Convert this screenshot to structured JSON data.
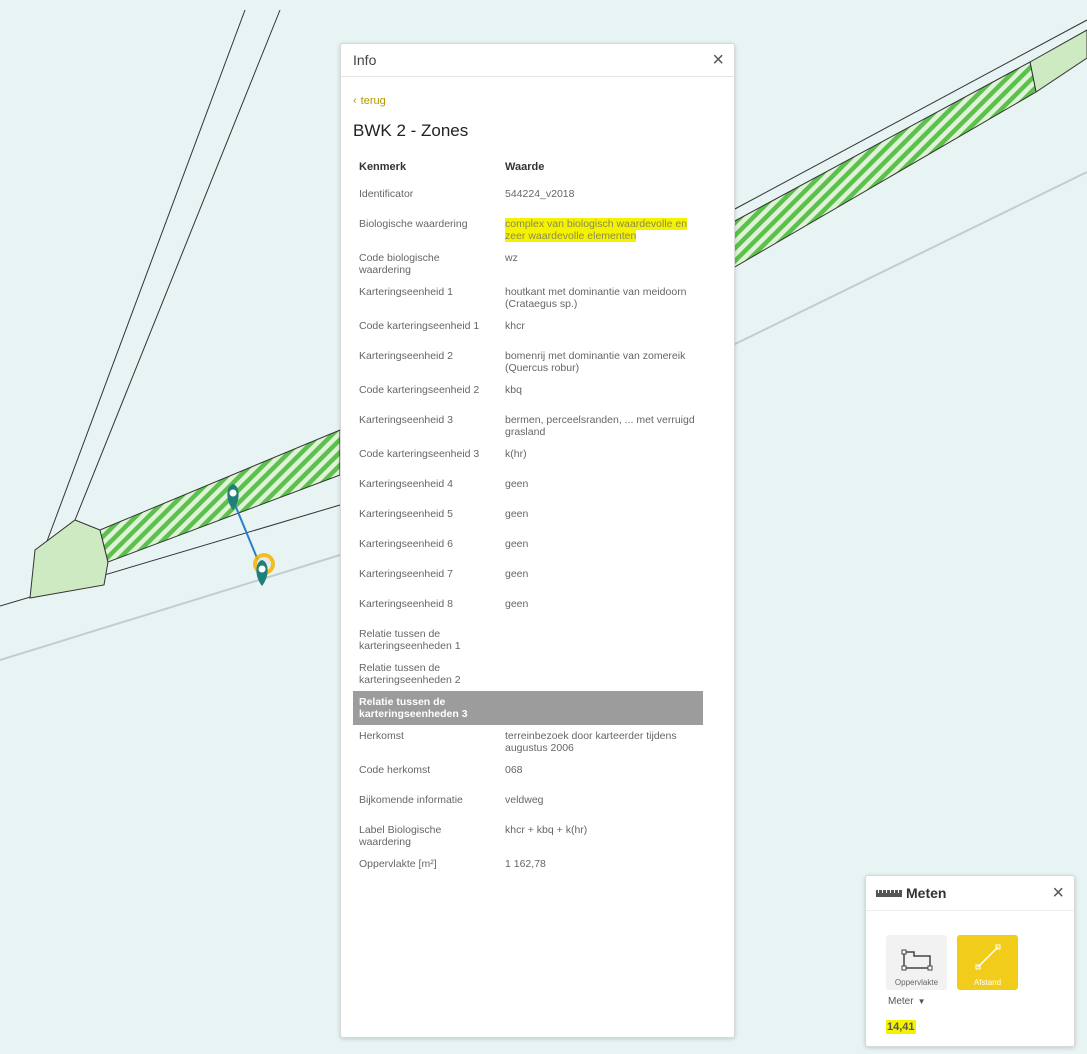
{
  "info_panel": {
    "title": "Info",
    "close": "×",
    "back": "terug",
    "back_icon": "‹",
    "layer_title": "BWK 2 - Zones",
    "header": {
      "key": "Kenmerk",
      "value": "Waarde"
    },
    "rows": [
      {
        "key": "Identificator",
        "value": "544224_v2018"
      },
      {
        "key": "Biologische waardering",
        "value": "complex van biologisch waardevolle en zeer waardevolle elementen"
      },
      {
        "key": "Code biologische waardering",
        "value": "wz"
      },
      {
        "key": "Karteringseenheid 1",
        "value": "houtkant met dominantie van meidoorn (Crataegus sp.)"
      },
      {
        "key": "Code karteringseenheid 1",
        "value": "khcr"
      },
      {
        "key": "Karteringseenheid 2",
        "value": "bomenrij met dominantie van zomereik (Quercus robur)"
      },
      {
        "key": "Code karteringseenheid 2",
        "value": "kbq"
      },
      {
        "key": "Karteringseenheid 3",
        "value": "bermen, perceelsranden, ... met verruigd grasland"
      },
      {
        "key": "Code karteringseenheid 3",
        "value": "k(hr)"
      },
      {
        "key": "Karteringseenheid 4",
        "value": "geen"
      },
      {
        "key": "Karteringseenheid 5",
        "value": "geen"
      },
      {
        "key": "Karteringseenheid 6",
        "value": "geen"
      },
      {
        "key": "Karteringseenheid 7",
        "value": "geen"
      },
      {
        "key": "Karteringseenheid 8",
        "value": "geen"
      },
      {
        "key": "Relatie tussen de karteringseenheden 1",
        "value": ""
      },
      {
        "key": "Relatie tussen de karteringseenheden 2",
        "value": ""
      },
      {
        "key": "Relatie tussen de karteringseenheden 3",
        "value": ""
      },
      {
        "key": "Herkomst",
        "value": "terreinbezoek door karteerder tijdens augustus 2006"
      },
      {
        "key": "Code herkomst",
        "value": "068"
      },
      {
        "key": "Bijkomende informatie",
        "value": "veldweg"
      },
      {
        "key": "Label Biologische waardering",
        "value": "khcr + kbq + k(hr)"
      },
      {
        "key": "Oppervlakte [m²]",
        "value": "1 162,78"
      }
    ]
  },
  "meten_panel": {
    "title": "Meten",
    "icon": "ruler-icon",
    "close": "×",
    "tools": [
      {
        "label": "Oppervlakte",
        "icon": "area-icon"
      },
      {
        "label": "Afstand",
        "icon": "distance-icon"
      }
    ],
    "unit": "Meter",
    "unit_caret": "▼",
    "result": "14,41"
  },
  "colors": {
    "accent": "#f2cc1a",
    "highlight": "#f5f200",
    "map_bg": "#e8f4f4",
    "zone_green": "#6cc46c",
    "marker": "#1f7f7a"
  }
}
